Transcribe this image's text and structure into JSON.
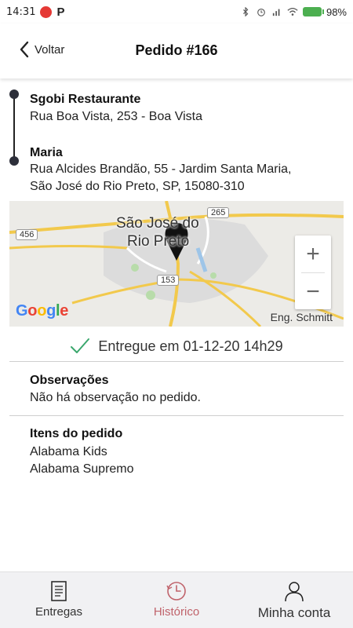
{
  "statusbar": {
    "time": "14:31",
    "app_p": "P",
    "battery": "98%"
  },
  "header": {
    "back_label": "Voltar",
    "title": "Pedido #166"
  },
  "route": {
    "origin_name": "Sgobi Restaurante",
    "origin_address": "Rua Boa Vista, 253 - Boa Vista",
    "destination_name": "Maria",
    "destination_address_line1": "Rua Alcides Brandão, 55 - Jardim Santa Maria,",
    "destination_address_line2": "São José do Rio Preto, SP, 15080-310"
  },
  "map": {
    "city_label_line1": "São José do",
    "city_label_line2": "Rio Preto",
    "road_265": "265",
    "road_456": "456",
    "road_153": "153",
    "place_eng": "Eng. Schmitt",
    "google_logo": "Google",
    "zoom_in": "+",
    "zoom_out": "−"
  },
  "status": {
    "text": "Entregue em 01-12-20 14h29",
    "icon": "check-icon",
    "color": "#3aa76d"
  },
  "observations": {
    "title": "Observações",
    "text": "Não há observação no pedido."
  },
  "items": {
    "title": "Itens do pedido",
    "list": [
      "Alabama Kids",
      "Alabama Supremo"
    ]
  },
  "nav": {
    "items": [
      {
        "label": "Entregas",
        "icon": "document-icon"
      },
      {
        "label": "Histórico",
        "icon": "clock-icon",
        "active": true
      },
      {
        "label": "Minha conta",
        "icon": "user-icon"
      }
    ],
    "active_color": "#c0636b"
  }
}
